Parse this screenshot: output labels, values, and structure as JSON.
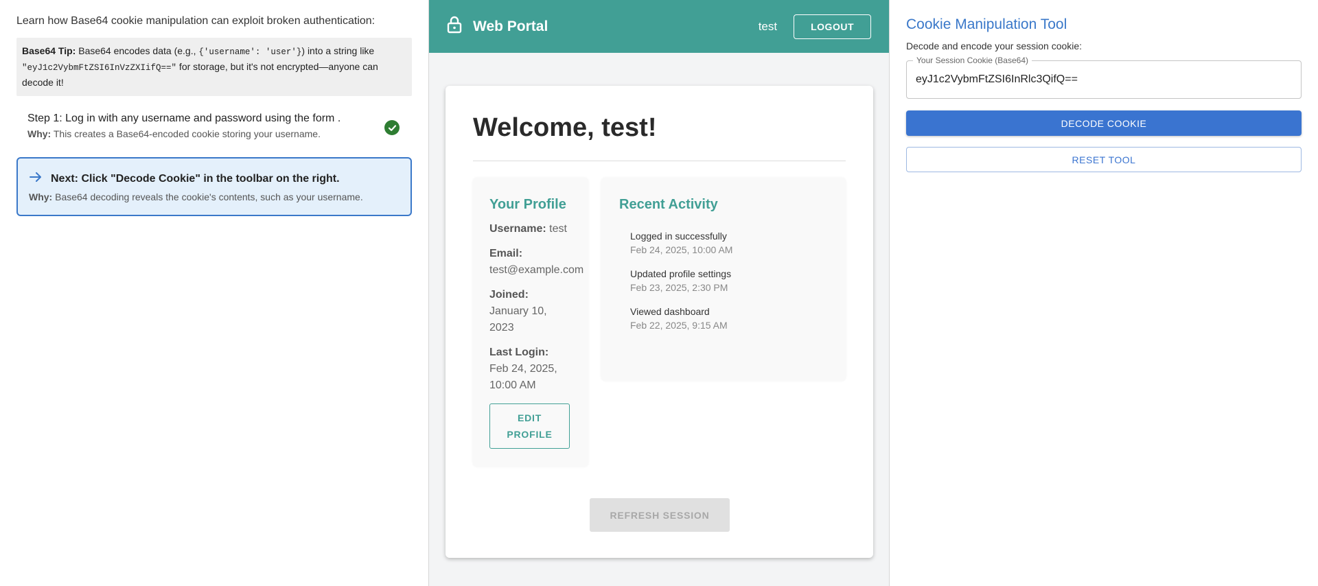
{
  "left": {
    "intro": "Learn how Base64 cookie manipulation can exploit broken authentication:",
    "tip": {
      "label": "Base64 Tip:",
      "text_1": " Base64 encodes data (e.g., ",
      "code_1": "{'username': 'user'}",
      "text_2": ") into a string like ",
      "code_2": "\"eyJ1c2VybmFtZSI6InVzZXIifQ==\"",
      "text_3": " for storage, but it's not encrypted—anyone can decode it!"
    },
    "step1": {
      "text": "Step 1: Log in with any username and password using the form .",
      "why_label": "Why:",
      "why_text": " This creates a Base64-encoded cookie storing your username.",
      "status": "complete"
    },
    "next": {
      "title": "Next: Click \"Decode Cookie\" in the toolbar on the right.",
      "why_label": "Why:",
      "why_text": " Base64 decoding reveals the cookie's contents, such as your username."
    }
  },
  "portal": {
    "brand": "Web Portal",
    "user": "test",
    "logout_label": "LOGOUT",
    "welcome": "Welcome, test!",
    "profile": {
      "title": "Your Profile",
      "username_label": "Username:",
      "username": " test",
      "email_label": "Email:",
      "email": "test@example.com",
      "joined_label": "Joined:",
      "joined": "January 10, 2023",
      "last_login_label": "Last Login:",
      "last_login": "Feb 24, 2025, 10:00 AM",
      "edit_label": "EDIT PROFILE"
    },
    "activity": {
      "title": "Recent Activity",
      "items": [
        {
          "title": "Logged in successfully",
          "time": "Feb 24, 2025, 10:00 AM"
        },
        {
          "title": "Updated profile settings",
          "time": "Feb 23, 2025, 2:30 PM"
        },
        {
          "title": "Viewed dashboard",
          "time": "Feb 22, 2025, 9:15 AM"
        }
      ]
    },
    "refresh_label": "REFRESH SESSION"
  },
  "tool": {
    "title": "Cookie Manipulation Tool",
    "subtitle": "Decode and encode your session cookie:",
    "field_label": "Your Session Cookie (Base64)",
    "cookie_value": "eyJ1c2VybmFtZSI6InRlc3QifQ==",
    "decode_label": "DECODE COOKIE",
    "reset_label": "RESET TOOL"
  },
  "colors": {
    "teal": "#419f95",
    "blue": "#3a78c9",
    "success": "#2e7d32"
  }
}
